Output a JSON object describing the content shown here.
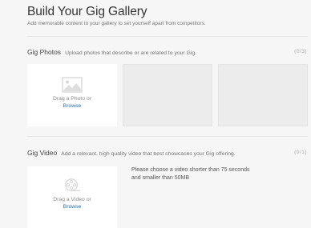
{
  "header": {
    "title": "Build Your Gig Gallery",
    "subtitle": "Add memorable content to your gallery to set yourself apart from competitors."
  },
  "photos": {
    "title": "Gig Photos",
    "description": "Upload photos that describe or are related to your Gig.",
    "counter": "(0/3)",
    "upload": {
      "text": "Drag a Photo or",
      "link": "Browse",
      "icon": "image-icon"
    }
  },
  "video": {
    "title": "Gig Video",
    "description": "Add a relevant, high quality video that best showcases your Gig offering.",
    "counter": "(0/1)",
    "upload": {
      "text": "Drag a Video or",
      "link": "Browse",
      "icon": "film-reel-icon"
    },
    "note": "Please choose a video shorter than 75 seconds and smaller than 50MB"
  }
}
